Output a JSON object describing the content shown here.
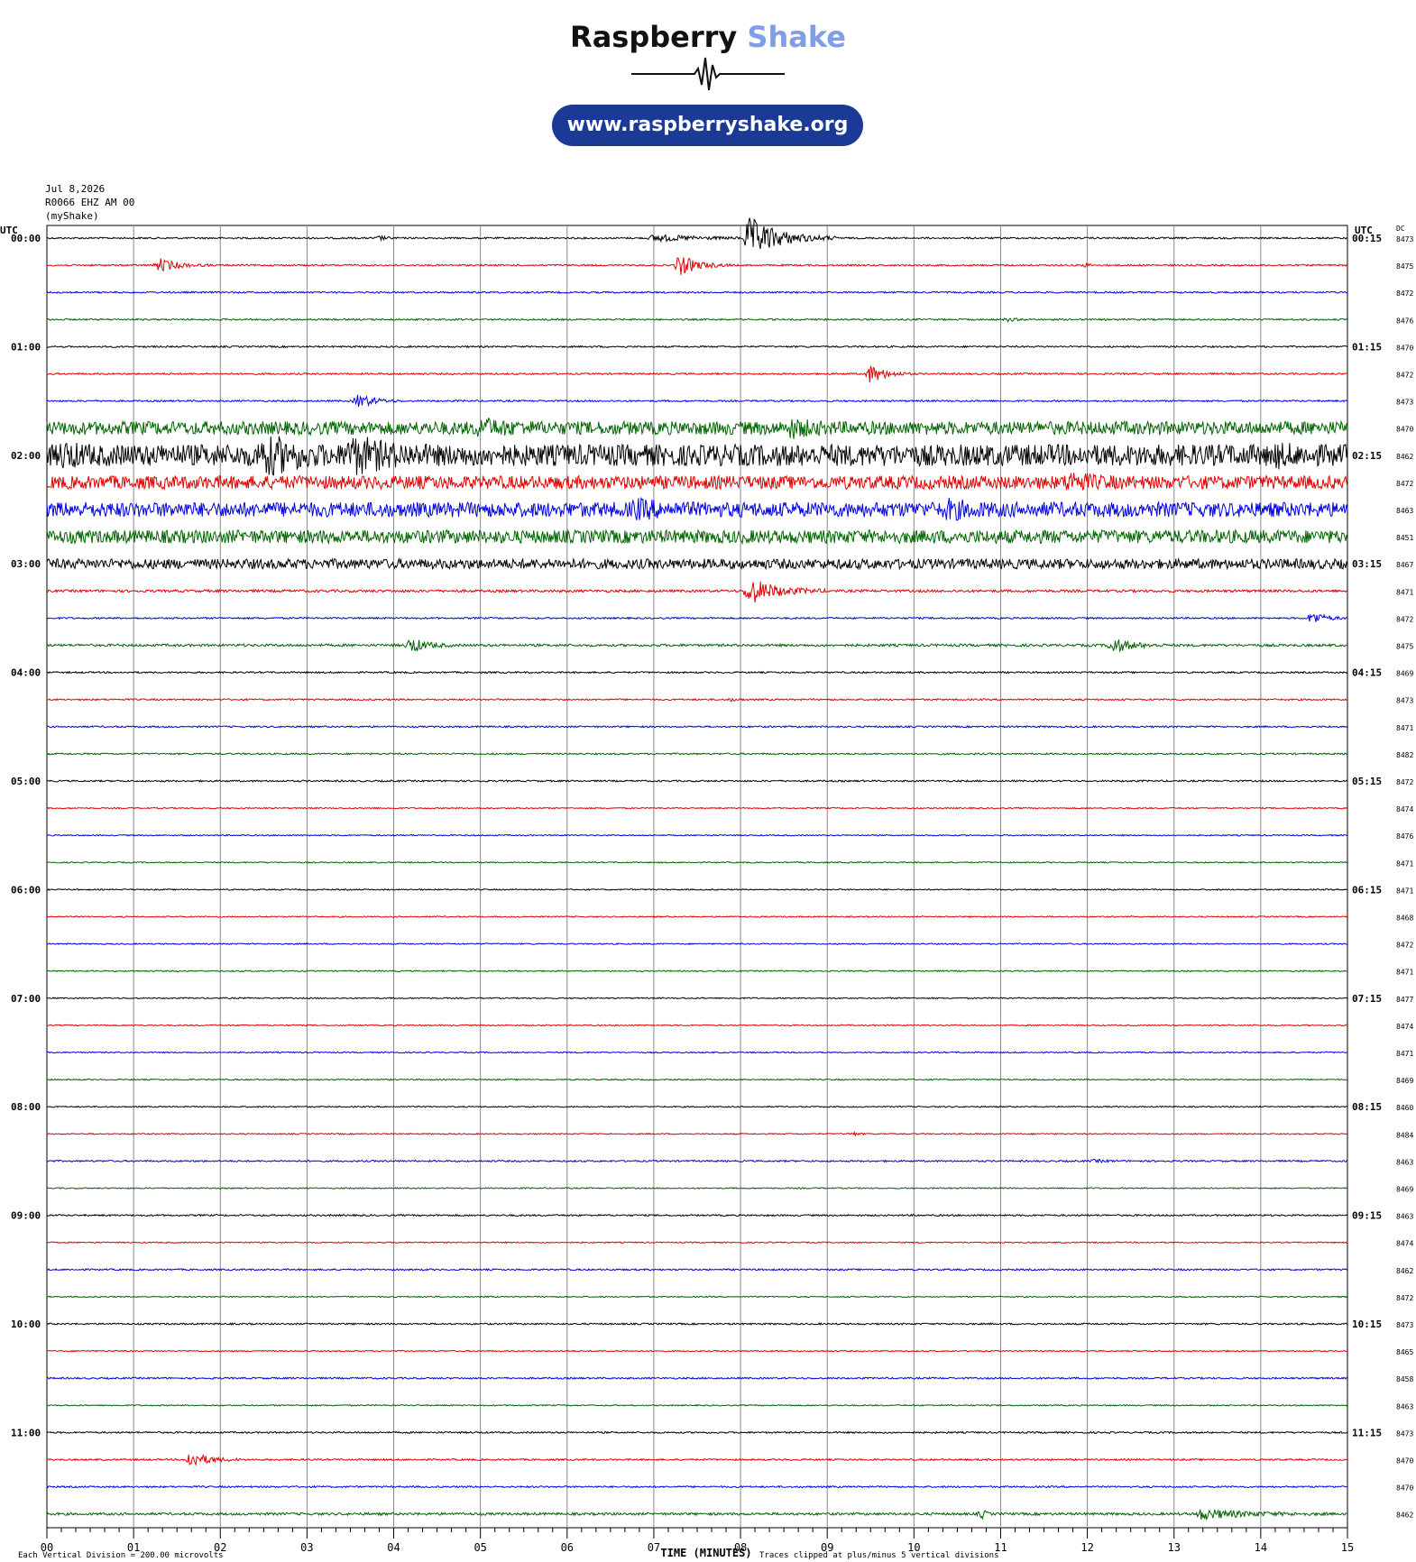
{
  "header": {
    "brand_primary": "Raspberry",
    "brand_secondary": "Shake",
    "url": "www.raspberryshake.org",
    "logo_icon": "seismogram-wave-icon"
  },
  "meta": {
    "date": "Jul 8,2026",
    "station": "R0066 EHZ AM 00",
    "source": "(myShake)"
  },
  "chart_data": {
    "type": "helicorder",
    "left_axis_title": "UTC",
    "right_axis_title": "UTC",
    "dc_header": "DC",
    "x_axis_label": "TIME (MINUTES)",
    "x_ticks": [
      "00",
      "01",
      "02",
      "03",
      "04",
      "05",
      "06",
      "07",
      "08",
      "09",
      "10",
      "11",
      "12",
      "13",
      "14",
      "15"
    ],
    "xlim": [
      0,
      15
    ],
    "scale_note": "Each Vertical Division =  200.00 microvolts",
    "clip_note": "Traces clipped at plus/minus 5 vertical divisions",
    "trace_colors": [
      "#000000",
      "#e00000",
      "#0000e0",
      "#006400"
    ],
    "left_hour_labels": [
      "00:00",
      "01:00",
      "02:00",
      "03:00",
      "04:00",
      "05:00",
      "06:00",
      "07:00",
      "08:00",
      "09:00",
      "10:00",
      "11:00"
    ],
    "right_hour_labels": [
      "00:15",
      "01:15",
      "02:15",
      "03:15",
      "04:15",
      "05:15",
      "06:15",
      "07:15",
      "08:15",
      "09:15",
      "10:15",
      "11:15"
    ],
    "dc_values": [
      "8473",
      "8475",
      "8472",
      "8476",
      "8470",
      "8472",
      "8473",
      "8470",
      "8462",
      "8472",
      "8463",
      "8451",
      "8467",
      "8471",
      "8472",
      "8475",
      "8469",
      "8473",
      "8471",
      "8482",
      "8472",
      "8474",
      "8476",
      "8471",
      "8471",
      "8468",
      "8472",
      "8471",
      "8477",
      "8474",
      "8471",
      "8469",
      "8460",
      "8484",
      "8463",
      "8469",
      "8463",
      "8474",
      "8462",
      "8472",
      "8473",
      "8465",
      "8458",
      "8463",
      "8473",
      "8470",
      "8470",
      "8462"
    ],
    "noise_levels": [
      0.2,
      0.2,
      0.2,
      0.2,
      0.2,
      0.2,
      0.2,
      1.6,
      2.6,
      1.6,
      1.8,
      1.6,
      1.2,
      0.3,
      0.2,
      0.3,
      0.2,
      0.2,
      0.2,
      0.2,
      0.2,
      0.15,
      0.15,
      0.15,
      0.15,
      0.15,
      0.15,
      0.15,
      0.15,
      0.15,
      0.15,
      0.15,
      0.15,
      0.15,
      0.2,
      0.15,
      0.2,
      0.15,
      0.2,
      0.15,
      0.2,
      0.15,
      0.2,
      0.15,
      0.2,
      0.2,
      0.2,
      0.3
    ],
    "events": [
      {
        "trace": 0,
        "minute": 8.1,
        "amplitude": 5,
        "duration": 1.0
      },
      {
        "trace": 0,
        "minute": 7.0,
        "amplitude": 0.8,
        "duration": 1.5
      },
      {
        "trace": 0,
        "minute": 3.85,
        "amplitude": 0.5,
        "duration": 0.2
      },
      {
        "trace": 1,
        "minute": 1.3,
        "amplitude": 1.6,
        "duration": 0.6
      },
      {
        "trace": 1,
        "minute": 7.3,
        "amplitude": 2.5,
        "duration": 0.6
      },
      {
        "trace": 1,
        "minute": 12.0,
        "amplitude": 0.4,
        "duration": 0.1
      },
      {
        "trace": 3,
        "minute": 11.1,
        "amplitude": 0.4,
        "duration": 0.2
      },
      {
        "trace": 5,
        "minute": 9.5,
        "amplitude": 2.2,
        "duration": 0.5
      },
      {
        "trace": 6,
        "minute": 3.6,
        "amplitude": 1.7,
        "duration": 0.5
      },
      {
        "trace": 7,
        "minute": 5.0,
        "amplitude": 1.3,
        "duration": 0.8
      },
      {
        "trace": 7,
        "minute": 8.6,
        "amplitude": 1.4,
        "duration": 0.5
      },
      {
        "trace": 8,
        "minute": 2.5,
        "amplitude": 4.5,
        "duration": 0.7
      },
      {
        "trace": 8,
        "minute": 3.5,
        "amplitude": 3.5,
        "duration": 0.9
      },
      {
        "trace": 8,
        "minute": 0.2,
        "amplitude": 1.6,
        "duration": 0.4
      },
      {
        "trace": 8,
        "minute": 14.2,
        "amplitude": 0.9,
        "duration": 0.4
      },
      {
        "trace": 9,
        "minute": 11.8,
        "amplitude": 1.6,
        "duration": 0.6
      },
      {
        "trace": 10,
        "minute": 6.8,
        "amplitude": 1.3,
        "duration": 0.7
      },
      {
        "trace": 10,
        "minute": 10.4,
        "amplitude": 1.3,
        "duration": 0.6
      },
      {
        "trace": 13,
        "minute": 8.1,
        "amplitude": 3.2,
        "duration": 0.9
      },
      {
        "trace": 14,
        "minute": 14.6,
        "amplitude": 1.6,
        "duration": 0.4
      },
      {
        "trace": 15,
        "minute": 4.2,
        "amplitude": 1.8,
        "duration": 0.5
      },
      {
        "trace": 15,
        "minute": 12.3,
        "amplitude": 1.8,
        "duration": 0.6
      },
      {
        "trace": 17,
        "minute": 7.9,
        "amplitude": 0.3,
        "duration": 0.3
      },
      {
        "trace": 33,
        "minute": 9.3,
        "amplitude": 0.4,
        "duration": 0.2
      },
      {
        "trace": 34,
        "minute": 12.1,
        "amplitude": 0.3,
        "duration": 0.3
      },
      {
        "trace": 45,
        "minute": 1.65,
        "amplitude": 2.0,
        "duration": 0.6
      },
      {
        "trace": 47,
        "minute": 13.3,
        "amplitude": 1.2,
        "duration": 1.5
      },
      {
        "trace": 47,
        "minute": 10.8,
        "amplitude": 1.0,
        "duration": 0.1
      }
    ]
  }
}
